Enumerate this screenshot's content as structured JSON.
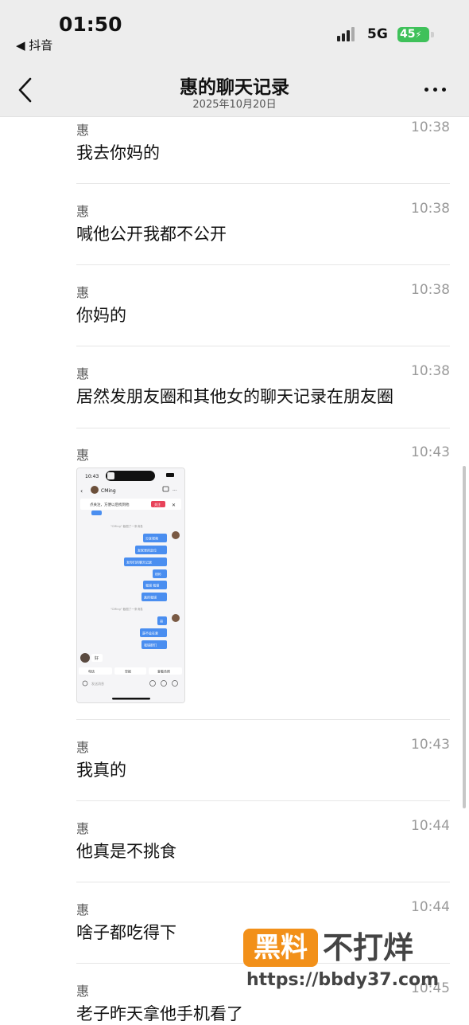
{
  "status_bar": {
    "time": "01:50",
    "back_app": "◀ 抖音",
    "network": "5G",
    "battery": "45"
  },
  "header": {
    "title": "惠的聊天记录",
    "subtitle": "2025年10月20日"
  },
  "messages": [
    {
      "sender": "惠",
      "time": "10:38",
      "text": "我去你妈的"
    },
    {
      "sender": "惠",
      "time": "10:38",
      "text": "喊他公开我都不公开"
    },
    {
      "sender": "惠",
      "time": "10:38",
      "text": "你妈的"
    },
    {
      "sender": "惠",
      "time": "10:38",
      "text": "居然发朋友圈和其他女的聊天记录在朋友圈"
    },
    {
      "sender": "惠",
      "time": "10:43",
      "image": "chat-screenshot"
    },
    {
      "sender": "惠",
      "time": "10:43",
      "text": "我真的"
    },
    {
      "sender": "惠",
      "time": "10:44",
      "text": "他真是不挑食"
    },
    {
      "sender": "惠",
      "time": "10:44",
      "text": "啥子都吃得下"
    },
    {
      "sender": "惠",
      "time": "10:45",
      "text": "老子昨天拿他手机看了"
    }
  ],
  "thumbnail": {
    "time": "10:43",
    "contact": "CMing",
    "banner": "点关注，方便以后找到他",
    "banner_btn": "关注",
    "sys1": "\"CMing\" 截图了一条消息",
    "sys2": "\"CMing\" 截图了一条消息",
    "bubbles": [
      "分享视频",
      "发家里的定位",
      "发你们的聊天记录",
      "886",
      "我错 我错",
      "真的我错",
      "哥",
      "是不会在意",
      "我错那们"
    ],
    "reply": "好",
    "tabs": [
      "电话",
      "举报",
      "查看合照"
    ],
    "input_placeholder": "发送消息"
  },
  "watermark": {
    "box": "黑料",
    "rest": "不打烊",
    "url": "https://bbdy37.com"
  }
}
